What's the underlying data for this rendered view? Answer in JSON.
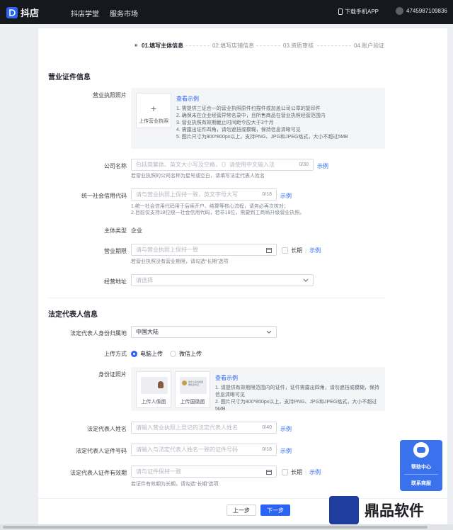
{
  "header": {
    "logo_text": "抖店",
    "nav": [
      "抖店学堂",
      "服务市场"
    ],
    "download_label": "下载手机APP",
    "user_id": "4745987109836"
  },
  "steps": [
    "01.填写主体信息",
    "02.填写店铺信息",
    "03.资质审核",
    "04.账户验证"
  ],
  "business_section": {
    "title": "营业证件信息",
    "license_label": "营业执照照片",
    "upload_text": "上传营业执照",
    "example_link": "查看示例",
    "rules": [
      "1. 需提供三证合一的营业执照原件扫描件或加盖公司公章的复印件",
      "2. 确保未在企业经营异常名录中，且所售商品在营业执照经营范围内",
      "3. 营业执照有效期截止时间距今应大于3个月",
      "4. 需露出证件四角，请勿遮挡或模糊，保持信息清晰可见",
      "5. 图片尺寸为800*800px以上，支持PNG、JPG和JPEG格式，大小不超过5MB"
    ],
    "company_label": "公司名称",
    "company_placeholder": "包括简繁体、英文大小写及空格，（）请使用中文输入法",
    "company_count": "0/30",
    "company_example": "示例",
    "company_hint": "若营业执照的公司名称为星号或空白，请填写法定代表人姓名",
    "credit_label": "统一社会信用代码",
    "credit_placeholder": "请与营业执照上保持一致，英文字母大写",
    "credit_count": "0/18",
    "credit_example": "示例",
    "credit_hints": [
      "1.统一社会信用代码用于后续开户、结算等核心流程，请务必再次核对；",
      "2.目前仅支持18位统一社会信用代码，若非18位，需要到工商局升级营业执照。"
    ],
    "entity_type_label": "主体类型",
    "entity_type_value": "企业",
    "term_label": "营业期限",
    "term_placeholder": "请与营业执照上保持一致",
    "term_longterm": "长期",
    "term_example": "示例",
    "term_hint": "若营业执照没有营业期限，请勾选“长期”选项",
    "address_label": "经营地址",
    "address_placeholder": "请选择"
  },
  "legal_section": {
    "title": "法定代表人信息",
    "region_label": "法定代表人身份归属地",
    "region_value": "中国大陆",
    "method_label": "上传方式",
    "method_options": [
      "电脑上传",
      "微信上传"
    ],
    "id_label": "身份证照片",
    "id_front": "上传人像面",
    "id_back": "上传国徽面",
    "id_back_card_text": "中华人民共和国 居民身份证",
    "example_link": "查看示例",
    "rules": [
      "1. 请提供有效期限范围内的证件，证件需露出四角，请勿遮挡或模糊，保持信息清晰可见",
      "2. 图片尺寸为800*800px以上，支持PNG、JPG和JPEG格式，大小不超过5MB"
    ],
    "name_label": "法定代表人姓名",
    "name_placeholder": "请输入营业执照上登记的法定代表人姓名",
    "name_count": "0/40",
    "name_example": "示例",
    "idnum_label": "法定代表人证件号码",
    "idnum_placeholder": "请输入与法定代表人姓名一致的证件号码",
    "idnum_count": "0/18",
    "idnum_example": "示例",
    "validity_label": "法定代表人证件有效期",
    "validity_placeholder": "请与证件保持一致",
    "validity_longterm": "长期",
    "validity_example": "示例",
    "validity_hint": "若证件有效期为长期，请勾选“长期”选项"
  },
  "footer": {
    "prev": "上一步",
    "next": "下一步"
  },
  "float_widget": {
    "help": "帮助中心",
    "contact": "联系商服"
  },
  "watermark": {
    "text": "鼎品软件"
  },
  "colors": {
    "accent": "#2b63f2",
    "topbar": "#15181d"
  }
}
